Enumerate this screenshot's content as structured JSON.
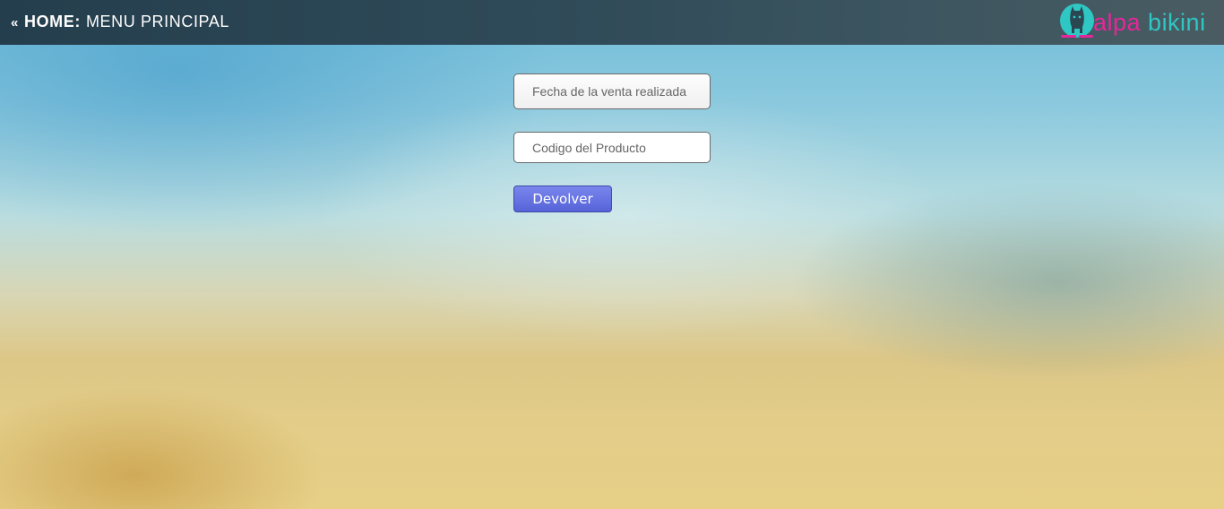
{
  "header": {
    "back_glyph": "«",
    "home_label": "HOME:",
    "menu_label": "MENU PRINCIPAL",
    "logo": {
      "alpa": "alpa",
      "bikini": "bikini",
      "colors": {
        "pink": "#e8259b",
        "teal": "#2fc7c3"
      }
    }
  },
  "form": {
    "date_placeholder": "Fecha de la venta realizada",
    "code_placeholder": "Codigo del Producto",
    "submit_label": "Devolver"
  },
  "colors": {
    "topbar": "#2f4a58",
    "button": "#5f6de0"
  }
}
